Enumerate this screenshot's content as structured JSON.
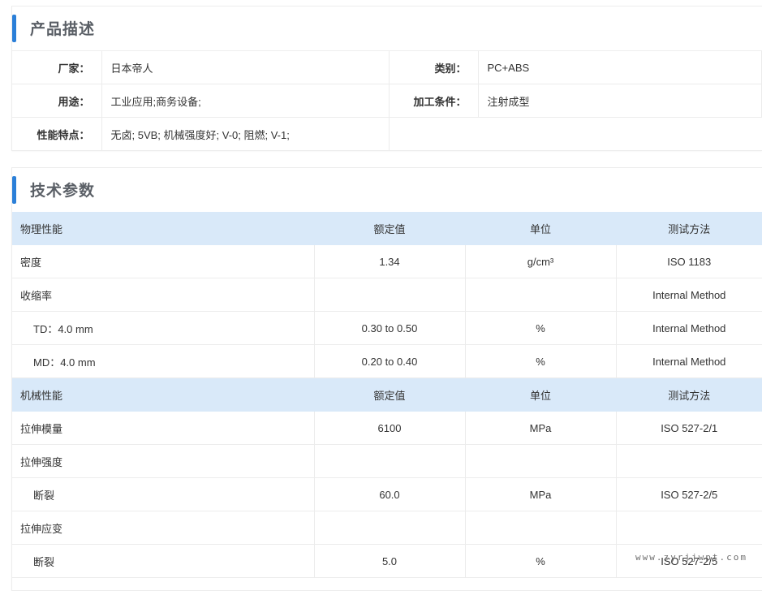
{
  "description": {
    "title": "产品描述",
    "rows": [
      [
        {
          "label": "厂家：",
          "value": "日本帝人"
        },
        {
          "label": "类别：",
          "value": "PC+ABS"
        }
      ],
      [
        {
          "label": "用途：",
          "value": "工业应用;商务设备;"
        },
        {
          "label": "加工条件：",
          "value": "注射成型"
        }
      ],
      [
        {
          "label": "性能特点：",
          "value": "无卤; 5VB; 机械强度好; V-0; 阻燃; V-1;"
        }
      ]
    ]
  },
  "tech": {
    "title": "技术参数",
    "rows": [
      {
        "group": true,
        "name": "物理性能",
        "value": "额定值",
        "unit": "单位",
        "method": "测试方法"
      },
      {
        "name": "密度",
        "value": "1.34",
        "unit": "g/cm³",
        "method": "ISO 1183"
      },
      {
        "name": "收缩率",
        "value": "",
        "unit": "",
        "method": "Internal Method"
      },
      {
        "sub": true,
        "name": "TD：4.0 mm",
        "value": "0.30 to 0.50",
        "unit": "%",
        "method": "Internal Method"
      },
      {
        "sub": true,
        "name": "MD：4.0 mm",
        "value": "0.20 to 0.40",
        "unit": "%",
        "method": "Internal Method"
      },
      {
        "group": true,
        "name": "机械性能",
        "value": "额定值",
        "unit": "单位",
        "method": "测试方法"
      },
      {
        "name": "拉伸模量",
        "value": "6100",
        "unit": "MPa",
        "method": "ISO 527-2/1"
      },
      {
        "name": "拉伸强度",
        "value": "",
        "unit": "",
        "method": ""
      },
      {
        "sub": true,
        "name": "断裂",
        "value": "60.0",
        "unit": "MPa",
        "method": "ISO 527-2/5"
      },
      {
        "name": "拉伸应变",
        "value": "",
        "unit": "",
        "method": ""
      },
      {
        "sub": true,
        "name": "断裂",
        "value": "5.0",
        "unit": "%",
        "method": "ISO 527-2/5"
      }
    ]
  },
  "watermark": "www.zyrjjwpt.com",
  "colors": {
    "accent": "#2b7fd8",
    "group_row": "#d9e9f9"
  }
}
